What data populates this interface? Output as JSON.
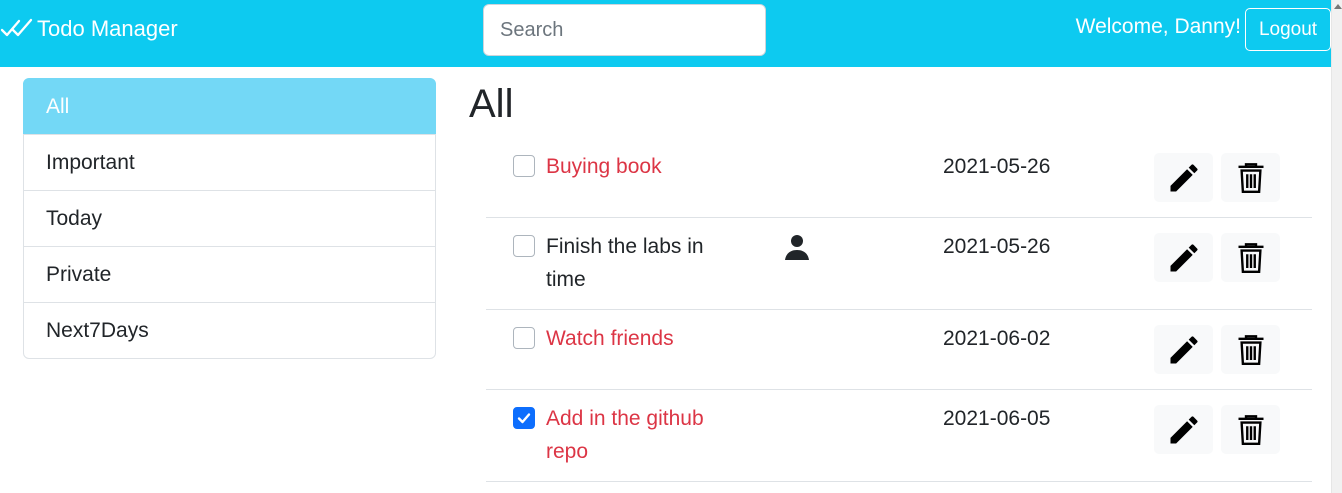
{
  "navbar": {
    "brand": "Todo Manager",
    "search_placeholder": "Search",
    "welcome": "Welcome, Danny!",
    "logout_label": "Logout",
    "background_color": "#0dcaf0"
  },
  "sidebar": {
    "items": [
      {
        "label": "All",
        "active": true
      },
      {
        "label": "Important",
        "active": false
      },
      {
        "label": "Today",
        "active": false
      },
      {
        "label": "Private",
        "active": false
      },
      {
        "label": "Next7Days",
        "active": false
      }
    ],
    "active_color": "#73d8f6"
  },
  "main": {
    "title": "All",
    "tasks": [
      {
        "description": "Buying book",
        "date": "2021-05-26",
        "completed": false,
        "important": true,
        "private": false
      },
      {
        "description": "Finish the labs in time",
        "date": "2021-05-26",
        "completed": false,
        "important": false,
        "private": true
      },
      {
        "description": "Watch friends",
        "date": "2021-06-02",
        "completed": false,
        "important": true,
        "private": false
      },
      {
        "description": "Add in the github repo",
        "date": "2021-06-05",
        "completed": true,
        "important": true,
        "private": false
      }
    ],
    "important_color": "#dc3545",
    "checked_color": "#0d6efd"
  },
  "icons": {
    "brand": "check-all-icon",
    "private": "person-icon",
    "edit": "pencil-icon",
    "delete": "trash-icon"
  }
}
